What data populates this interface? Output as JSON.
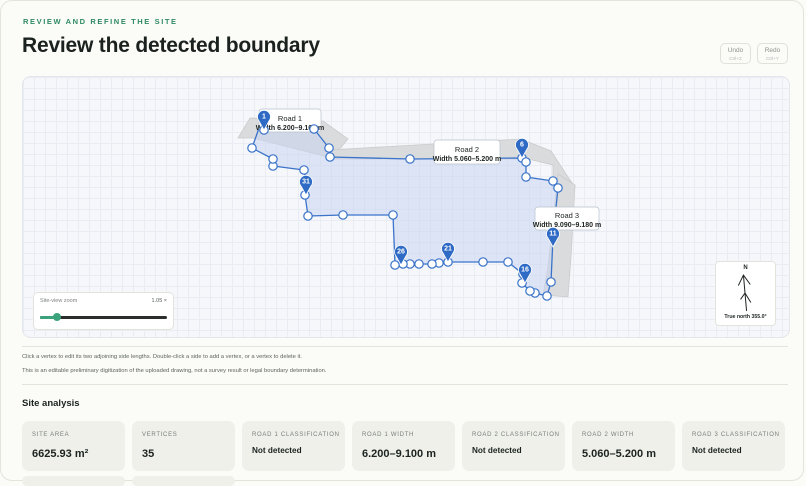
{
  "header": {
    "eyebrow": "REVIEW AND REFINE THE SITE",
    "title": "Review the detected boundary",
    "undo": {
      "label": "Undo",
      "shortcut": "Ctrl+Z"
    },
    "redo": {
      "label": "Redo",
      "shortcut": "Ctrl+Y"
    }
  },
  "map": {
    "roads": [
      {
        "name": "Road 1",
        "width": "Width 6.200–9.100 m"
      },
      {
        "name": "Road 2",
        "width": "Width 5.060–5.200 m"
      },
      {
        "name": "Road 3",
        "width": "Width 9.090–9.180 m"
      }
    ],
    "markers": [
      "1",
      "6",
      "11",
      "16",
      "21",
      "26",
      "31"
    ],
    "zoom": {
      "label": "Site-view zoom",
      "value": "1.05 ×",
      "level": 0.13
    },
    "compass": {
      "north": "N",
      "caption": "True north 355.0°"
    },
    "colors": {
      "boundary": "#3a73c9",
      "fill": "#dfe8f7",
      "road": "#d8dadb",
      "accent": "#3aa37b"
    }
  },
  "notes": {
    "instructions": "Click a vertex to edit its two adjoining side lengths. Double-click a side to add a vertex, or a vertex to delete it.",
    "disclaimer": "This is an editable preliminary digitization of the uploaded drawing, not a survey result or legal boundary determination."
  },
  "analysis": {
    "title": "Site analysis",
    "cards": [
      {
        "label": "SITE AREA",
        "value": "6625.93 m²"
      },
      {
        "label": "VERTICES",
        "value": "35"
      },
      {
        "label": "ROAD 1 CLASSIFICATION",
        "value": "Not detected"
      },
      {
        "label": "ROAD 1 WIDTH",
        "value": "6.200–9.100 m"
      },
      {
        "label": "ROAD 2 CLASSIFICATION",
        "value": "Not detected"
      },
      {
        "label": "ROAD 2 WIDTH",
        "value": "5.060–5.200 m"
      },
      {
        "label": "ROAD 3 CLASSIFICATION",
        "value": "Not detected"
      }
    ]
  }
}
